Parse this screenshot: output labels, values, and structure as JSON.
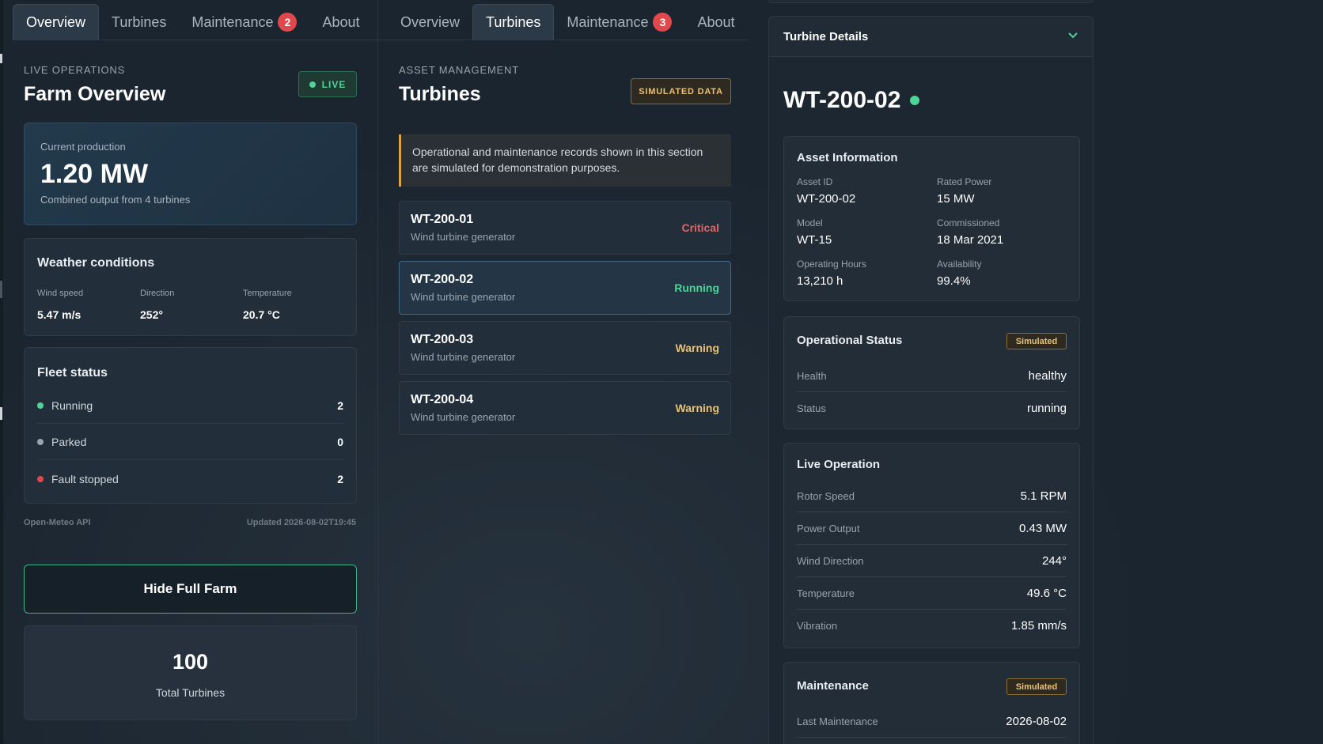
{
  "colors": {
    "live_green": "#4fd397",
    "critical": "#e06666",
    "running": "#4fd397",
    "warning": "#e8c27a",
    "parked": "#9aa5af",
    "fault": "#e0484b"
  },
  "panel_a": {
    "tabs": [
      {
        "label": "Overview",
        "badge": ""
      },
      {
        "label": "Turbines",
        "badge": ""
      },
      {
        "label": "Maintenance",
        "badge": "2"
      },
      {
        "label": "About",
        "badge": ""
      }
    ],
    "eyebrow": "LIVE OPERATIONS",
    "title": "Farm Overview",
    "live_label": "LIVE",
    "production": {
      "label": "Current production",
      "value": "1.20 MW",
      "sub": "Combined output from 4 turbines"
    },
    "weather": {
      "title": "Weather conditions",
      "items": [
        {
          "label": "Wind speed",
          "value": "5.47 m/s"
        },
        {
          "label": "Direction",
          "value": "252°"
        },
        {
          "label": "Temperature",
          "value": "20.7 °C"
        }
      ]
    },
    "fleet": {
      "title": "Fleet status",
      "rows": [
        {
          "label": "Running",
          "value": "2",
          "color": "#4fd397"
        },
        {
          "label": "Parked",
          "value": "0",
          "color": "#9aa5af"
        },
        {
          "label": "Fault stopped",
          "value": "2",
          "color": "#e0484b"
        }
      ]
    },
    "source": "Open-Meteo API",
    "updated": "Updated 2026-08-02T19:45",
    "hide_button": "Hide Full Farm",
    "total": {
      "value": "100",
      "label": "Total Turbines"
    }
  },
  "panel_b": {
    "tabs": [
      {
        "label": "Overview",
        "badge": ""
      },
      {
        "label": "Turbines",
        "badge": ""
      },
      {
        "label": "Maintenance",
        "badge": "3"
      },
      {
        "label": "About",
        "badge": ""
      }
    ],
    "eyebrow": "ASSET MANAGEMENT",
    "title": "Turbines",
    "simulated_label": "SIMULATED DATA",
    "notice": "Operational and maintenance records shown in this section are simulated for demonstration purposes.",
    "turbines": [
      {
        "id": "WT-200-01",
        "sub": "Wind turbine generator",
        "status": "Critical",
        "color": "#e06666"
      },
      {
        "id": "WT-200-02",
        "sub": "Wind turbine generator",
        "status": "Running",
        "color": "#4fd397"
      },
      {
        "id": "WT-200-03",
        "sub": "Wind turbine generator",
        "status": "Warning",
        "color": "#e8c27a"
      },
      {
        "id": "WT-200-04",
        "sub": "Wind turbine generator",
        "status": "Warning",
        "color": "#e8c27a"
      }
    ]
  },
  "panel_c": {
    "header": "Turbine Details",
    "turbine_id": "WT-200-02",
    "asset_info": {
      "title": "Asset Information",
      "items": [
        {
          "label": "Asset ID",
          "value": "WT-200-02"
        },
        {
          "label": "Rated Power",
          "value": "15 MW"
        },
        {
          "label": "Model",
          "value": "WT-15"
        },
        {
          "label": "Commissioned",
          "value": "18 Mar 2021"
        },
        {
          "label": "Operating Hours",
          "value": "13,210 h"
        },
        {
          "label": "Availability",
          "value": "99.4%"
        }
      ]
    },
    "operational": {
      "title": "Operational Status",
      "badge": "Simulated",
      "rows": [
        {
          "label": "Health",
          "value": "healthy"
        },
        {
          "label": "Status",
          "value": "running"
        }
      ]
    },
    "live": {
      "title": "Live Operation",
      "rows": [
        {
          "label": "Rotor Speed",
          "value": "5.1 RPM"
        },
        {
          "label": "Power Output",
          "value": "0.43 MW"
        },
        {
          "label": "Wind Direction",
          "value": "244°"
        },
        {
          "label": "Temperature",
          "value": "49.6 °C"
        },
        {
          "label": "Vibration",
          "value": "1.85 mm/s"
        }
      ]
    },
    "maintenance": {
      "title": "Maintenance",
      "badge": "Simulated",
      "rows": [
        {
          "label": "Last Maintenance",
          "value": "2026-08-02"
        }
      ]
    }
  }
}
